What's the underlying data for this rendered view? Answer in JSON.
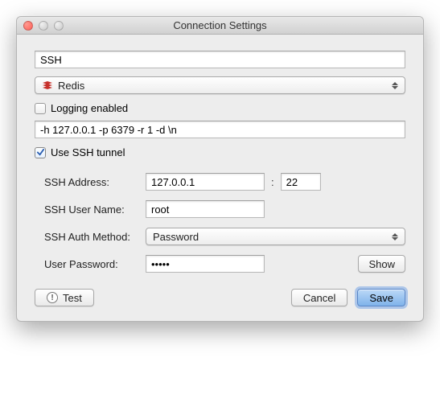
{
  "window": {
    "title": "Connection Settings"
  },
  "name_field": {
    "value": "SSH"
  },
  "type_select": {
    "label": "Redis"
  },
  "logging": {
    "label": "Logging enabled",
    "checked": false
  },
  "command_field": {
    "value": "-h 127.0.0.1 -p 6379 -r 1 -d \\n"
  },
  "ssh_tunnel": {
    "label": "Use SSH tunnel",
    "checked": true
  },
  "ssh": {
    "address_label": "SSH Address:",
    "address_value": "127.0.0.1",
    "port_value": "22",
    "user_label": "SSH User Name:",
    "user_value": "root",
    "auth_label": "SSH Auth Method:",
    "auth_value": "Password",
    "password_label": "User Password:",
    "password_value": "•••••",
    "show_button": "Show"
  },
  "buttons": {
    "test": "Test",
    "cancel": "Cancel",
    "save": "Save"
  }
}
